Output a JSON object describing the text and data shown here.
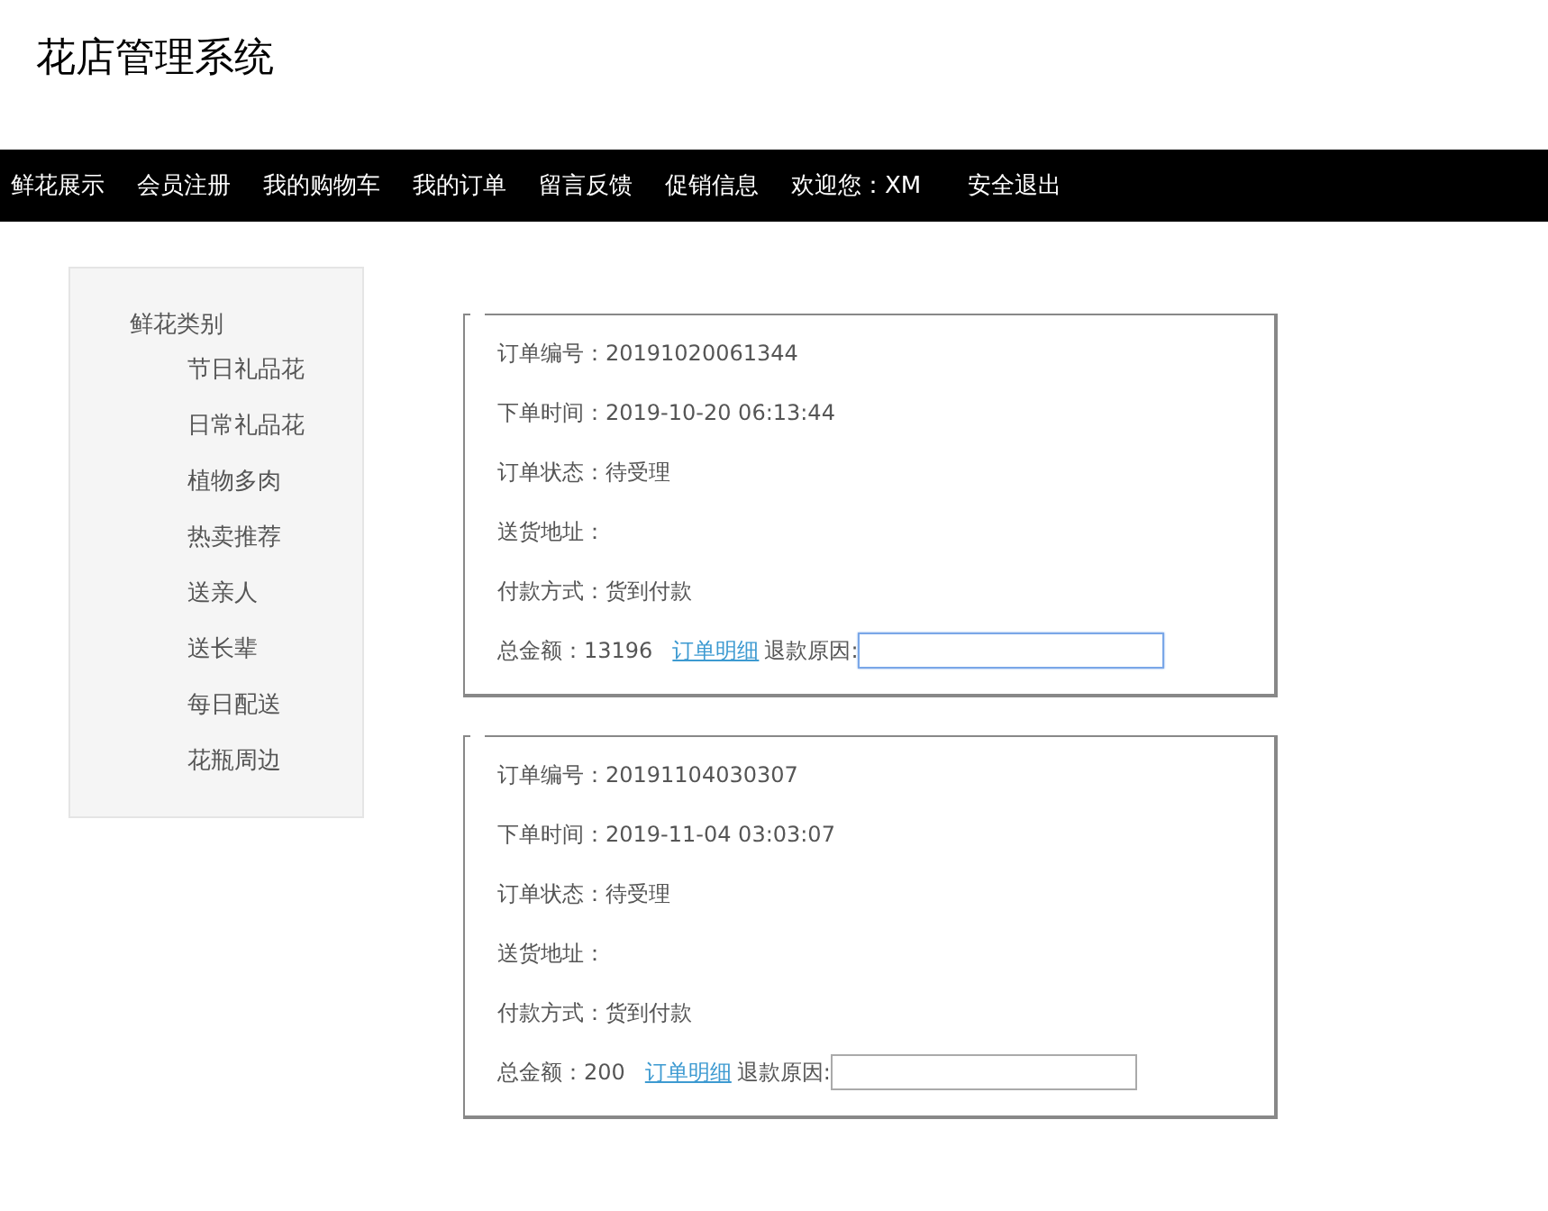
{
  "site_title": "花店管理系统",
  "nav": [
    "鲜花展示",
    "会员注册",
    "我的购物车",
    "我的订单",
    "留言反馈",
    "促销信息",
    "欢迎您：XM",
    "安全退出"
  ],
  "sidebar": {
    "heading": "鲜花类别",
    "items": [
      "节日礼品花",
      "日常礼品花",
      "植物多肉",
      "热卖推荐",
      "送亲人",
      "送长辈",
      "每日配送",
      "花瓶周边"
    ]
  },
  "orders": [
    {
      "fields": [
        "订单编号：20191020061344",
        "下单时间：2019-10-20 06:13:44",
        "订单状态：待受理",
        "送货地址：",
        "付款方式：货到付款"
      ],
      "total": "总金额：13196",
      "detail_link": "订单明细",
      "refund_label": "退款原因:",
      "refund_focused": true
    },
    {
      "fields": [
        "订单编号：20191104030307",
        "下单时间：2019-11-04 03:03:07",
        "订单状态：待受理",
        "送货地址：",
        "付款方式：货到付款"
      ],
      "total": "总金额：200",
      "detail_link": "订单明细",
      "refund_label": "退款原因:",
      "refund_focused": false
    }
  ]
}
